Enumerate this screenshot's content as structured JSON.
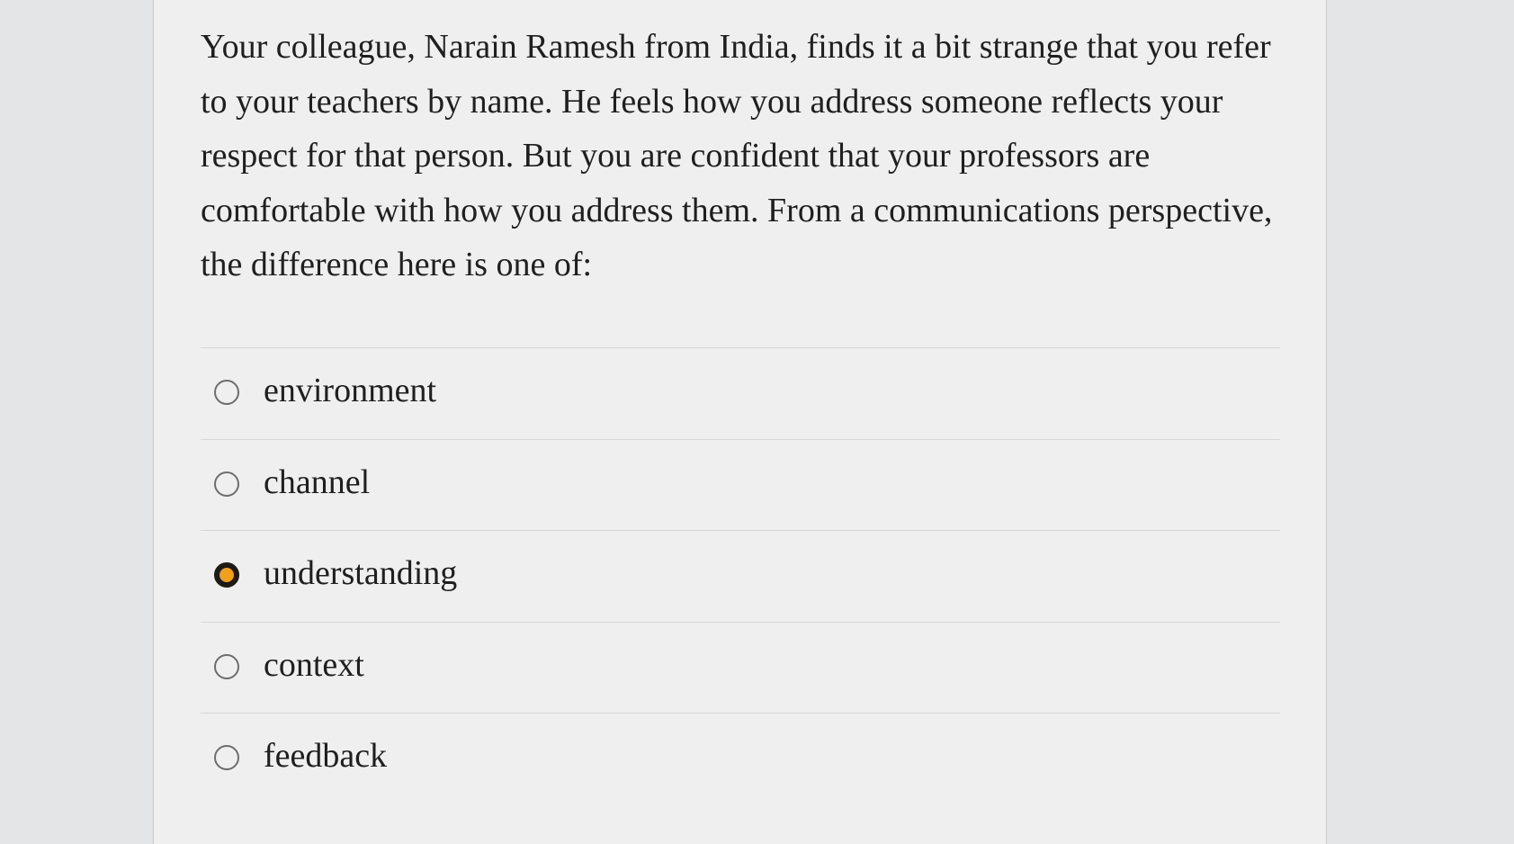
{
  "question": {
    "text": "Your colleague, Narain Ramesh from India, finds it a bit strange that you refer to your teachers by name. He feels how you address someone reflects your respect for that person. But you are confident that your professors are comfortable with how you address them. From a communications perspective, the difference here is one of:"
  },
  "options": [
    {
      "label": "environment",
      "selected": false
    },
    {
      "label": "channel",
      "selected": false
    },
    {
      "label": "understanding",
      "selected": true
    },
    {
      "label": "context",
      "selected": false
    },
    {
      "label": "feedback",
      "selected": false
    }
  ],
  "colors": {
    "selected_radio_fill": "#f0a01c",
    "selected_radio_ring": "#1e1a14",
    "unselected_radio_ring": "#6d6d6d"
  }
}
